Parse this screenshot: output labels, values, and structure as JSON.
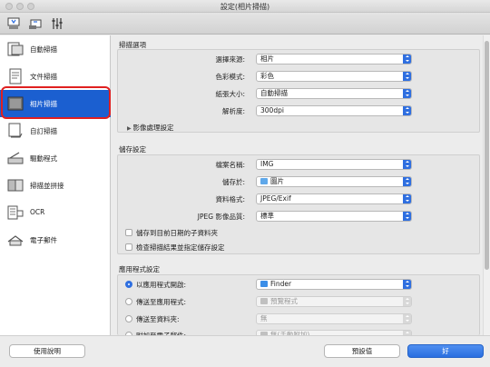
{
  "window": {
    "title": "設定(相片掃描)"
  },
  "toolbar": {
    "icons": [
      "scan-from-computer-icon",
      "scan-from-operation-panel-icon",
      "general-settings-icon"
    ]
  },
  "sidebar": {
    "items": [
      {
        "label": "自動掃描",
        "icon": "auto-scan-icon"
      },
      {
        "label": "文件掃描",
        "icon": "document-scan-icon"
      },
      {
        "label": "相片掃描",
        "icon": "photo-scan-icon",
        "active": true
      },
      {
        "label": "自訂掃描",
        "icon": "custom-scan-icon"
      },
      {
        "label": "驅動程式",
        "icon": "driver-icon"
      },
      {
        "label": "掃描並拼接",
        "icon": "scan-and-stitch-icon"
      },
      {
        "label": "OCR",
        "icon": "ocr-icon"
      },
      {
        "label": "電子郵件",
        "icon": "email-icon"
      }
    ]
  },
  "scan_options": {
    "title": "掃描選項",
    "fields": [
      {
        "label": "選擇來源:",
        "value": "相片"
      },
      {
        "label": "色彩模式:",
        "value": "彩色"
      },
      {
        "label": "紙張大小:",
        "value": "自動掃描"
      },
      {
        "label": "解析度:",
        "value": "300dpi"
      }
    ],
    "image_processing": "影像處理設定"
  },
  "save_settings": {
    "title": "儲存設定",
    "fields": [
      {
        "label": "檔案名稱:",
        "value": "IMG"
      },
      {
        "label": "儲存於:",
        "value": "圖片"
      },
      {
        "label": "資料格式:",
        "value": "JPEG/Exif"
      },
      {
        "label": "JPEG 影像品質:",
        "value": "標準"
      }
    ],
    "checkboxes": [
      {
        "label": "儲存到目前日期的子資料夾",
        "checked": false
      },
      {
        "label": "檢查掃描結果並指定儲存設定",
        "checked": false
      }
    ]
  },
  "app_settings": {
    "title": "應用程式設定",
    "options": [
      {
        "label": "以應用程式開啟:",
        "value": "Finder",
        "selected": true,
        "enabled": true
      },
      {
        "label": "傳送至應用程式:",
        "value": "預覽程式",
        "selected": false,
        "enabled": false
      },
      {
        "label": "傳送至資料夾:",
        "value": "無",
        "selected": false,
        "enabled": false
      },
      {
        "label": "附加至電子郵件:",
        "value": "無(手動附加)",
        "selected": false,
        "enabled": false
      }
    ]
  },
  "buttons": {
    "help": "使用說明",
    "defaults": "預設值",
    "ok": "好"
  },
  "colors": {
    "accent": "#2f6fe0",
    "selection": "#1b5fd0",
    "highlight_ring": "#e02020"
  }
}
